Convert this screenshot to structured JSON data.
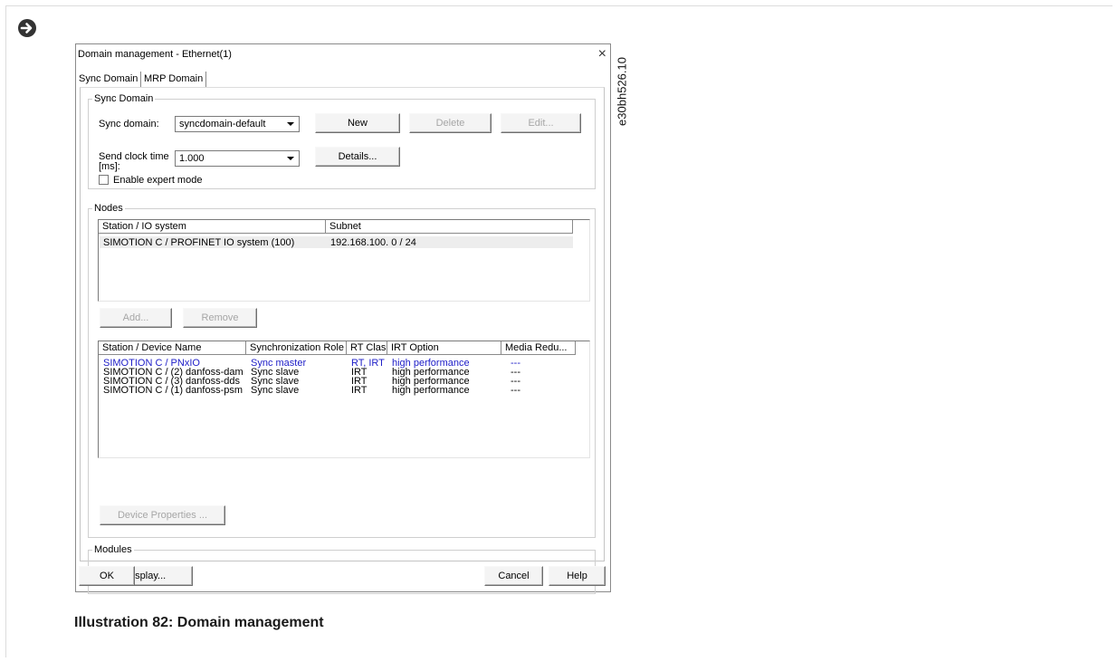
{
  "dialog": {
    "title": "Domain management - Ethernet(1)",
    "close_glyph": "×",
    "tabs": [
      {
        "label": "Sync Domain",
        "active": true
      },
      {
        "label": "MRP Domain",
        "active": false
      }
    ],
    "sync_group": {
      "legend": "Sync Domain",
      "sync_domain_label": "Sync domain:",
      "sync_domain_value": "syncdomain-default",
      "new_label": "New",
      "delete_label": "Delete",
      "edit_label": "Edit...",
      "send_clock_label_1": "Send clock time",
      "send_clock_label_2": "[ms]:",
      "send_clock_value": "1.000",
      "details_label": "Details...",
      "expert_mode_label": "Enable expert mode"
    },
    "nodes_group": {
      "legend": "Nodes",
      "io_columns": [
        "Station / IO system",
        "Subnet"
      ],
      "io_rows": [
        {
          "station": "SIMOTION C / PROFINET IO system (100)",
          "subnet": "192.168.100. 0 / 24"
        }
      ],
      "add_label": "Add...",
      "remove_label": "Remove",
      "device_columns": [
        "Station / Device Name",
        "Synchronization Role",
        "RT Class",
        "IRT Option",
        "Media Redu..."
      ],
      "device_rows": [
        {
          "name": "SIMOTION C / PNxIO",
          "role": "Sync master",
          "rt_class": "RT, IRT",
          "irt_option": "high performance",
          "media": "---",
          "highlight": true
        },
        {
          "name": "SIMOTION C / (2) danfoss-dam",
          "role": "Sync slave",
          "rt_class": "IRT",
          "irt_option": "high performance",
          "media": "---",
          "highlight": false
        },
        {
          "name": "SIMOTION C / (3) danfoss-dds",
          "role": "Sync slave",
          "rt_class": "IRT",
          "irt_option": "high performance",
          "media": "---",
          "highlight": false
        },
        {
          "name": "SIMOTION C / (1) danfoss-psm",
          "role": "Sync slave",
          "rt_class": "IRT",
          "irt_option": "high performance",
          "media": "---",
          "highlight": false
        }
      ],
      "device_properties_label": "Device Properties ..."
    },
    "modules_group": {
      "legend": "Modules",
      "display_label": "Display..."
    },
    "footer": {
      "ok_label": "OK",
      "cancel_label": "Cancel",
      "help_label": "Help"
    }
  },
  "figure_id": "e30bh526.10",
  "caption": "Illustration 82: Domain management",
  "colors": {
    "highlight_text": "#2020c8"
  }
}
